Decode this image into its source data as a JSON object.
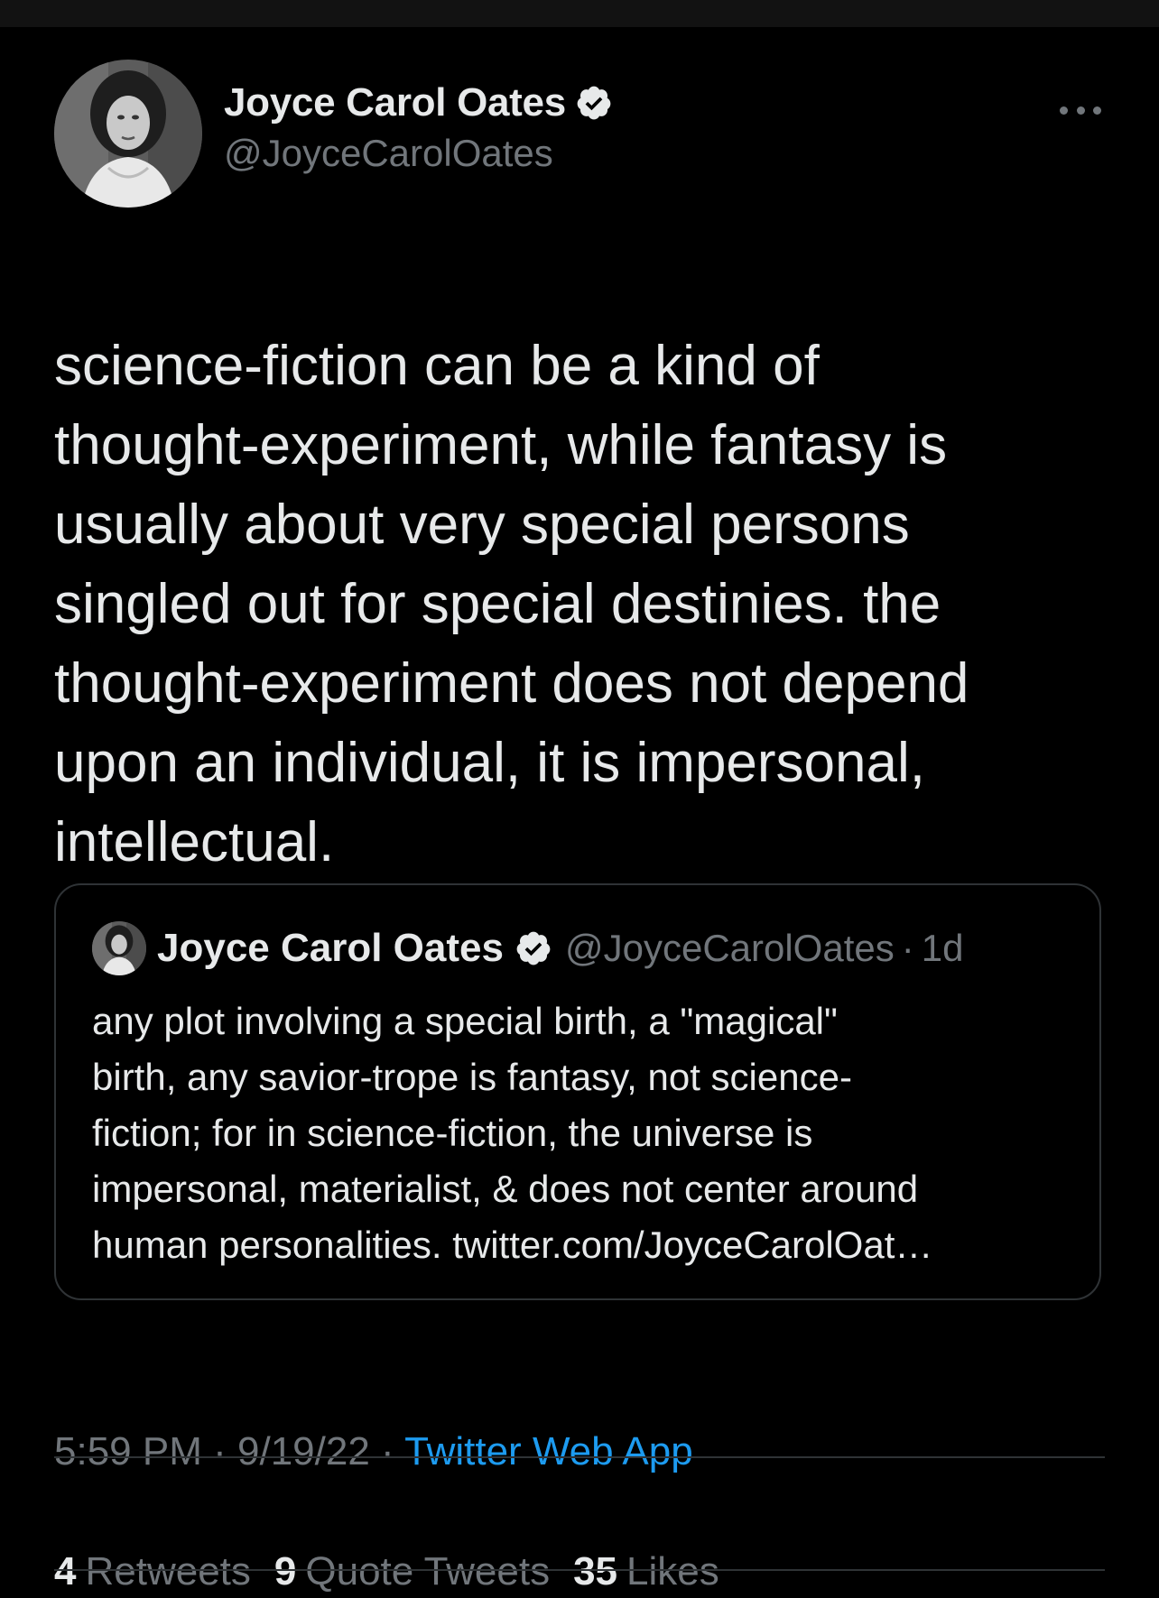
{
  "tweet": {
    "author": {
      "display_name": "Joyce Carol Oates",
      "handle": "@JoyceCarolOates",
      "verified": true
    },
    "more_icon": "more-horizontal-icon",
    "text": "science-fiction can be a kind of\nthought-experiment, while fantasy is\nusually about very special persons\nsingled out for special destinies. the\nthought-experiment does not depend\nupon an individual, it is impersonal,\nintellectual.",
    "quoted": {
      "display_name": "Joyce Carol Oates",
      "handle": "@JoyceCarolOates",
      "separator": "·",
      "time": "1d",
      "text": "any plot involving a special birth, a \"magical\"\nbirth, any savior-trope is fantasy, not science-\nfiction; for in science-fiction, the universe is\nimpersonal, materialist, & does not center around\nhuman personalities. twitter.com/JoyceCarolOat…"
    },
    "meta": {
      "time": "5:59 PM",
      "sep1": "·",
      "date": "9/19/22",
      "sep2": "·",
      "source": "Twitter Web App"
    },
    "stats": {
      "retweets_count": "4",
      "retweets_label": "Retweets",
      "quotes_count": "9",
      "quotes_label": "Quote Tweets",
      "likes_count": "35",
      "likes_label": "Likes"
    }
  },
  "colors": {
    "background": "#000000",
    "primary_text": "#e7e9ea",
    "secondary_text": "#71767b",
    "link": "#1d9bf0",
    "border": "#2f3336"
  }
}
